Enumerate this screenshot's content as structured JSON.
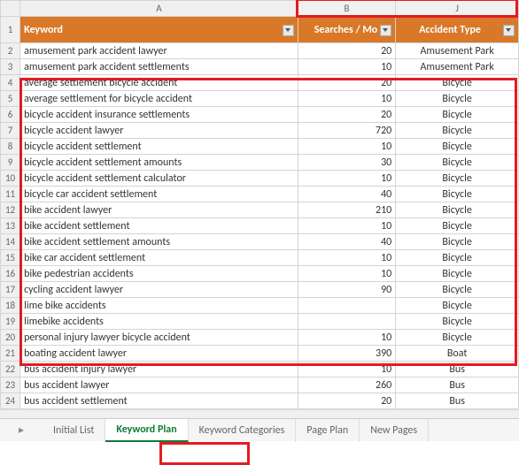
{
  "columns": {
    "a": "A",
    "b": "B",
    "j": "J"
  },
  "headers": {
    "keyword": "Keyword",
    "searches": "Searches / Mo",
    "accident_type": "Accident Type"
  },
  "rows": [
    {
      "n": 2,
      "k": "amusement park accident lawyer",
      "s": "20",
      "t": "Amusement Park"
    },
    {
      "n": 3,
      "k": "amusement park accident settlements",
      "s": "10",
      "t": "Amusement Park"
    },
    {
      "n": 4,
      "k": "average settlement bicycle accident",
      "s": "20",
      "t": "Bicycle"
    },
    {
      "n": 5,
      "k": "average settlement for bicycle accident",
      "s": "10",
      "t": "Bicycle"
    },
    {
      "n": 6,
      "k": "bicycle accident insurance settlements",
      "s": "20",
      "t": "Bicycle"
    },
    {
      "n": 7,
      "k": "bicycle accident lawyer",
      "s": "720",
      "t": "Bicycle"
    },
    {
      "n": 8,
      "k": "bicycle accident settlement",
      "s": "10",
      "t": "Bicycle"
    },
    {
      "n": 9,
      "k": "bicycle accident settlement amounts",
      "s": "30",
      "t": "Bicycle"
    },
    {
      "n": 10,
      "k": "bicycle accident settlement calculator",
      "s": "10",
      "t": "Bicycle"
    },
    {
      "n": 11,
      "k": "bicycle car accident settlement",
      "s": "40",
      "t": "Bicycle"
    },
    {
      "n": 12,
      "k": "bike accident lawyer",
      "s": "210",
      "t": "Bicycle"
    },
    {
      "n": 13,
      "k": "bike accident settlement",
      "s": "10",
      "t": "Bicycle"
    },
    {
      "n": 14,
      "k": "bike accident settlement amounts",
      "s": "40",
      "t": "Bicycle"
    },
    {
      "n": 15,
      "k": "bike car accident settlement",
      "s": "10",
      "t": "Bicycle"
    },
    {
      "n": 16,
      "k": "bike pedestrian accidents",
      "s": "10",
      "t": "Bicycle"
    },
    {
      "n": 17,
      "k": "cycling accident lawyer",
      "s": "90",
      "t": "Bicycle"
    },
    {
      "n": 18,
      "k": "lime bike accidents",
      "s": "",
      "t": "Bicycle"
    },
    {
      "n": 19,
      "k": "limebike accidents",
      "s": "",
      "t": "Bicycle"
    },
    {
      "n": 20,
      "k": "personal injury lawyer bicycle accident",
      "s": "10",
      "t": "Bicycle"
    },
    {
      "n": 21,
      "k": "boating accident lawyer",
      "s": "390",
      "t": "Boat"
    },
    {
      "n": 22,
      "k": "bus accident injury lawyer",
      "s": "10",
      "t": "Bus"
    },
    {
      "n": 23,
      "k": "bus accident lawyer",
      "s": "260",
      "t": "Bus"
    },
    {
      "n": 24,
      "k": "bus accident settlement",
      "s": "20",
      "t": "Bus"
    }
  ],
  "tabs": {
    "nav": "▸",
    "items": [
      "Initial List",
      "Keyword Plan",
      "Keyword Categories",
      "Page Plan",
      "New Pages"
    ],
    "active": 1
  }
}
